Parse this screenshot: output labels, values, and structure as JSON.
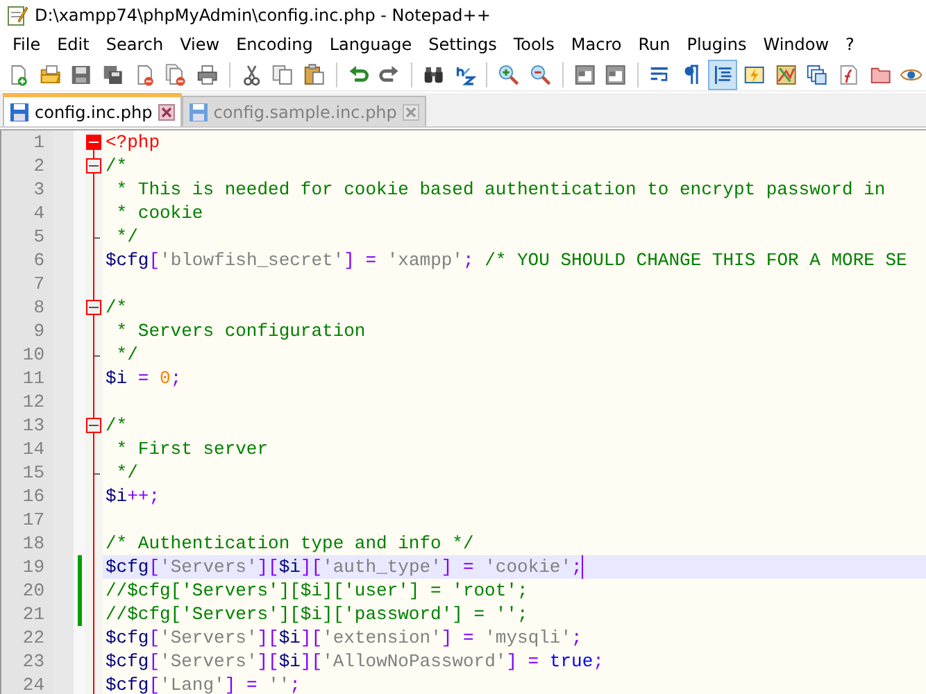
{
  "window": {
    "title": "D:\\xampp74\\phpMyAdmin\\config.inc.php - Notepad++"
  },
  "menu": [
    "File",
    "Edit",
    "Search",
    "View",
    "Encoding",
    "Language",
    "Settings",
    "Tools",
    "Macro",
    "Run",
    "Plugins",
    "Window",
    "?"
  ],
  "toolbar": [
    {
      "kind": "new",
      "pressed": false
    },
    {
      "kind": "open",
      "pressed": false
    },
    {
      "kind": "save",
      "pressed": false
    },
    {
      "kind": "saveall",
      "pressed": false
    },
    {
      "kind": "close",
      "pressed": false
    },
    {
      "kind": "closeall",
      "pressed": false
    },
    {
      "kind": "print",
      "pressed": false
    },
    {
      "kind": "sep"
    },
    {
      "kind": "cut",
      "pressed": false
    },
    {
      "kind": "copy",
      "pressed": false
    },
    {
      "kind": "paste",
      "pressed": false
    },
    {
      "kind": "sep"
    },
    {
      "kind": "undo",
      "pressed": false
    },
    {
      "kind": "redo",
      "pressed": false
    },
    {
      "kind": "sep"
    },
    {
      "kind": "find",
      "pressed": false
    },
    {
      "kind": "replace",
      "pressed": false
    },
    {
      "kind": "sep"
    },
    {
      "kind": "zoomin",
      "pressed": false
    },
    {
      "kind": "zoomout",
      "pressed": false
    },
    {
      "kind": "sep"
    },
    {
      "kind": "syncv",
      "pressed": false
    },
    {
      "kind": "synch",
      "pressed": false
    },
    {
      "kind": "sep"
    },
    {
      "kind": "wrap",
      "pressed": false
    },
    {
      "kind": "pilcrow",
      "pressed": false
    },
    {
      "kind": "indent",
      "pressed": true
    },
    {
      "kind": "udl",
      "pressed": false
    },
    {
      "kind": "map",
      "pressed": false
    },
    {
      "kind": "doclist",
      "pressed": false
    },
    {
      "kind": "func",
      "pressed": false
    },
    {
      "kind": "folder",
      "pressed": false
    },
    {
      "kind": "eye",
      "pressed": false
    }
  ],
  "tabs": [
    {
      "label": "config.inc.php",
      "selected": true
    },
    {
      "label": "config.sample.inc.php",
      "selected": false
    }
  ],
  "editor": {
    "lines": [
      {
        "number": "1",
        "kind": "active-header",
        "tokens": [
          {
            "kind": "tag",
            "text": "<?php"
          }
        ]
      },
      {
        "number": "2",
        "kind": "header",
        "tokens": [
          {
            "kind": "comment",
            "text": "/*"
          }
        ]
      },
      {
        "number": "3",
        "tokens": [
          {
            "kind": "comment",
            "text": " * This is needed for cookie based authentication to encrypt password in"
          }
        ]
      },
      {
        "number": "4",
        "tokens": [
          {
            "kind": "comment",
            "text": " * cookie"
          }
        ]
      },
      {
        "number": "5",
        "kind": "end",
        "tokens": [
          {
            "kind": "comment",
            "text": " */"
          }
        ]
      },
      {
        "number": "6",
        "tokens": [
          {
            "kind": "var",
            "text": "$cfg"
          },
          {
            "kind": "op",
            "text": "["
          },
          {
            "kind": "str",
            "text": "'blowfish_secret'"
          },
          {
            "kind": "op",
            "text": "] = "
          },
          {
            "kind": "str",
            "text": "'xampp'"
          },
          {
            "kind": "op",
            "text": "; "
          },
          {
            "kind": "comment",
            "text": "/* YOU SHOULD CHANGE THIS FOR A MORE SE"
          }
        ]
      },
      {
        "number": "7"
      },
      {
        "number": "8",
        "kind": "header",
        "tokens": [
          {
            "kind": "comment",
            "text": "/*"
          }
        ]
      },
      {
        "number": "9",
        "tokens": [
          {
            "kind": "comment",
            "text": " * Servers configuration"
          }
        ]
      },
      {
        "number": "10",
        "kind": "end",
        "tokens": [
          {
            "kind": "comment",
            "text": " */"
          }
        ]
      },
      {
        "number": "11",
        "tokens": [
          {
            "kind": "var",
            "text": "$i"
          },
          {
            "kind": "op",
            "text": " = "
          },
          {
            "kind": "num",
            "text": "0"
          },
          {
            "kind": "op",
            "text": ";"
          }
        ]
      },
      {
        "number": "12"
      },
      {
        "number": "13",
        "kind": "header",
        "tokens": [
          {
            "kind": "comment",
            "text": "/*"
          }
        ]
      },
      {
        "number": "14",
        "tokens": [
          {
            "kind": "comment",
            "text": " * First server"
          }
        ]
      },
      {
        "number": "15",
        "kind": "end",
        "tokens": [
          {
            "kind": "comment",
            "text": " */"
          }
        ]
      },
      {
        "number": "16",
        "tokens": [
          {
            "kind": "var",
            "text": "$i"
          },
          {
            "kind": "op",
            "text": "++;"
          }
        ]
      },
      {
        "number": "17"
      },
      {
        "number": "18",
        "tokens": [
          {
            "kind": "comment",
            "text": "/* Authentication type and info */"
          }
        ]
      },
      {
        "number": "19",
        "changed": true,
        "current": true,
        "tokens": [
          {
            "kind": "var",
            "text": "$cfg"
          },
          {
            "kind": "op",
            "text": "["
          },
          {
            "kind": "str",
            "text": "'Servers'"
          },
          {
            "kind": "op",
            "text": "]["
          },
          {
            "kind": "var",
            "text": "$i"
          },
          {
            "kind": "op",
            "text": "]["
          },
          {
            "kind": "str",
            "text": "'auth_type'"
          },
          {
            "kind": "op",
            "text": "] = "
          },
          {
            "kind": "str",
            "text": "'cookie'"
          },
          {
            "kind": "op",
            "text": ";"
          }
        ]
      },
      {
        "number": "20",
        "changed": true,
        "tokens": [
          {
            "kind": "comment",
            "text": "//$cfg['Servers'][$i]['user'] = 'root';"
          }
        ]
      },
      {
        "number": "21",
        "changed": true,
        "tokens": [
          {
            "kind": "comment",
            "text": "//$cfg['Servers'][$i]['password'] = '';"
          }
        ]
      },
      {
        "number": "22",
        "tokens": [
          {
            "kind": "var",
            "text": "$cfg"
          },
          {
            "kind": "op",
            "text": "["
          },
          {
            "kind": "str",
            "text": "'Servers'"
          },
          {
            "kind": "op",
            "text": "]["
          },
          {
            "kind": "var",
            "text": "$i"
          },
          {
            "kind": "op",
            "text": "]["
          },
          {
            "kind": "str",
            "text": "'extension'"
          },
          {
            "kind": "op",
            "text": "] = "
          },
          {
            "kind": "str",
            "text": "'mysqli'"
          },
          {
            "kind": "op",
            "text": ";"
          }
        ]
      },
      {
        "number": "23",
        "tokens": [
          {
            "kind": "var",
            "text": "$cfg"
          },
          {
            "kind": "op",
            "text": "["
          },
          {
            "kind": "str",
            "text": "'Servers'"
          },
          {
            "kind": "op",
            "text": "]["
          },
          {
            "kind": "var",
            "text": "$i"
          },
          {
            "kind": "op",
            "text": "]["
          },
          {
            "kind": "str",
            "text": "'AllowNoPassword'"
          },
          {
            "kind": "op",
            "text": "] = "
          },
          {
            "kind": "kw",
            "text": "true"
          },
          {
            "kind": "op",
            "text": ";"
          }
        ]
      },
      {
        "number": "24",
        "tokens": [
          {
            "kind": "var",
            "text": "$cfg"
          },
          {
            "kind": "op",
            "text": "["
          },
          {
            "kind": "str",
            "text": "'Lang'"
          },
          {
            "kind": "op",
            "text": "] = "
          },
          {
            "kind": "str",
            "text": "''"
          },
          {
            "kind": "op",
            "text": ";"
          }
        ]
      }
    ]
  }
}
